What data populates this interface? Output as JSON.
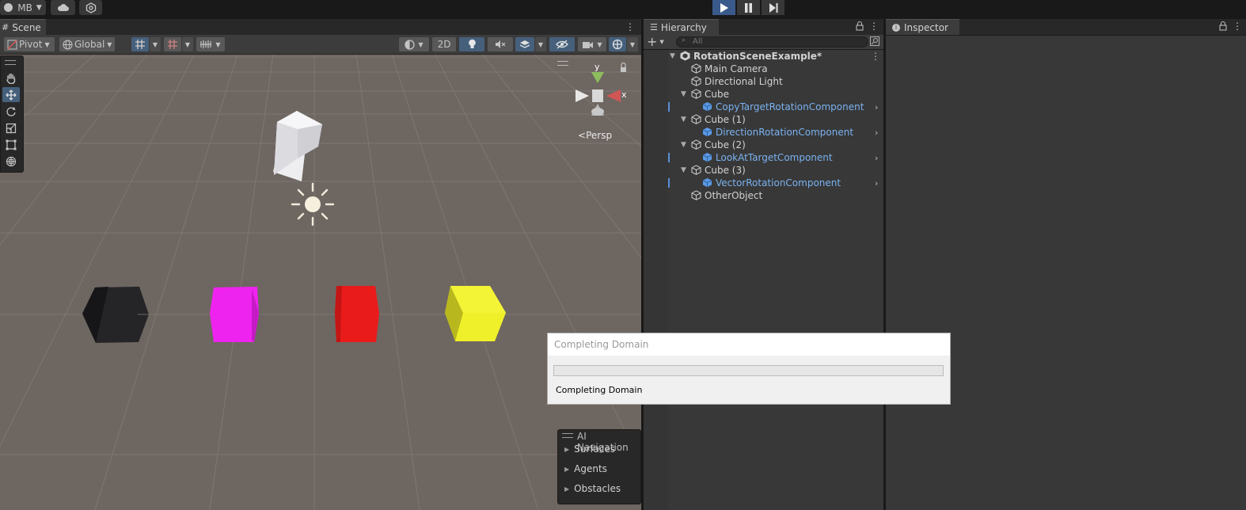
{
  "topbar": {
    "account_label": "MB",
    "account_icon": "account-icon",
    "cloud_icon": "cloud-icon",
    "settings_icon": "collab-icon",
    "play_icon": "play-icon",
    "pause_icon": "pause-icon",
    "step_icon": "step-icon",
    "play_active_color": "#3a5a8c"
  },
  "scene": {
    "tab_label": "Scene",
    "pivot_label": "Pivot",
    "global_label": "Global",
    "mode_2d_label": "2D",
    "persp_label": "Persp",
    "gizmo_axes": {
      "y": "y",
      "x": "x"
    },
    "tools": [
      "view-hand-icon",
      "move-icon",
      "rotate-icon",
      "scale-icon",
      "rect-icon",
      "transform-icon"
    ],
    "objects": [
      {
        "name": "white-cube",
        "color": "#e8e8ea"
      },
      {
        "name": "black-cube",
        "color": "#1f1f21"
      },
      {
        "name": "magenta-cube",
        "color": "#ee22ee"
      },
      {
        "name": "red-cube",
        "color": "#e81a1a"
      },
      {
        "name": "yellow-cube",
        "color": "#eeee22"
      }
    ]
  },
  "hierarchy": {
    "tab_label": "Hierarchy",
    "search_placeholder": "All",
    "add_label": "+",
    "root": "RotationSceneExample*",
    "rows": [
      {
        "label": "Main Camera",
        "type": "gameobject"
      },
      {
        "label": "Directional Light",
        "type": "gameobject"
      },
      {
        "label": "Cube",
        "type": "gameobject",
        "expanded": true
      },
      {
        "label": "CopyTargetRotationComponent",
        "type": "prefab"
      },
      {
        "label": "Cube (1)",
        "type": "gameobject",
        "expanded": true
      },
      {
        "label": "DirectionRotationComponent",
        "type": "prefab"
      },
      {
        "label": "Cube (2)",
        "type": "gameobject",
        "expanded": true
      },
      {
        "label": "LookAtTargetComponent",
        "type": "prefab"
      },
      {
        "label": "Cube (3)",
        "type": "gameobject",
        "expanded": true
      },
      {
        "label": "VectorRotationComponent",
        "type": "prefab"
      },
      {
        "label": "OtherObject",
        "type": "gameobject"
      }
    ]
  },
  "inspector": {
    "tab_label": "Inspector"
  },
  "dialog": {
    "title": "Completing Domain",
    "message": "Completing Domain",
    "progress": 0
  },
  "ai_navigation": {
    "title": "AI Navigation",
    "items": [
      "Surfaces",
      "Agents",
      "Obstacles"
    ]
  }
}
